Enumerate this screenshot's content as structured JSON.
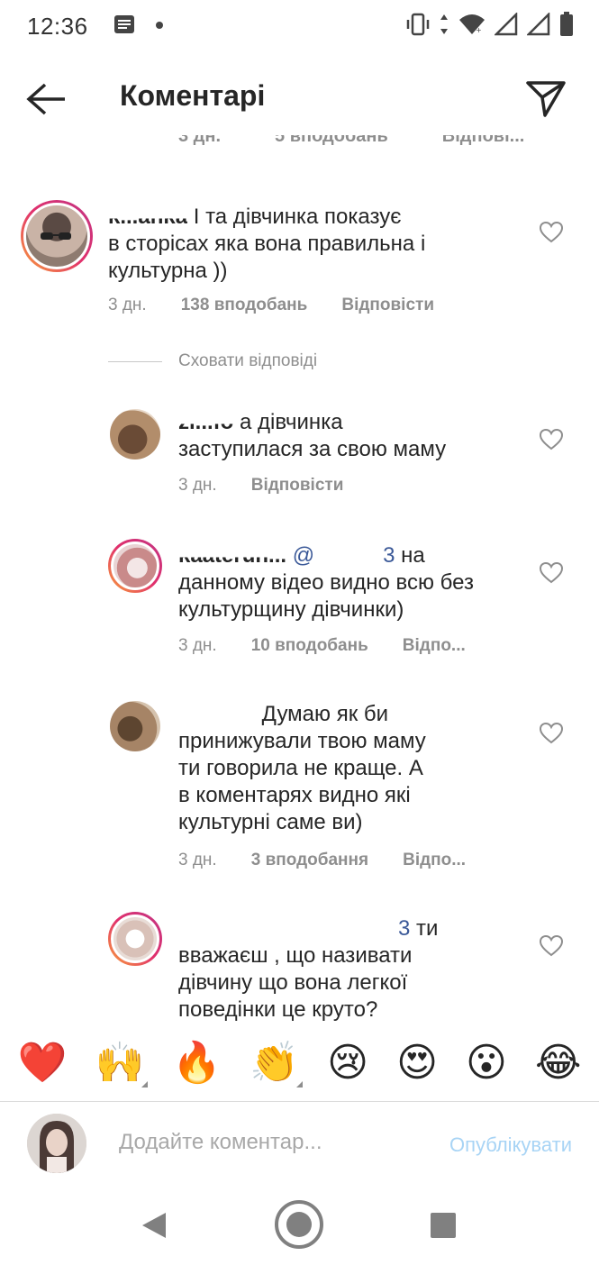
{
  "status_bar": {
    "time": "12:36",
    "icons_left": [
      "notes-icon",
      "dot-icon"
    ],
    "icons_right": [
      "vibrate-icon",
      "data-arrows-icon",
      "wifi-icon",
      "signal-icon",
      "signal-icon-2",
      "battery-icon"
    ]
  },
  "header": {
    "title": "Коментарі",
    "back_icon": "arrow-left-icon",
    "share_icon": "paper-plane-icon"
  },
  "cut_top": {
    "time": "3 дн.",
    "likes": "5 вподобань",
    "reply": "Відпові..."
  },
  "hide_replies_label": "Сховати відповіді",
  "comments": [
    {
      "username": "k...anka",
      "text_line1": "І та дівчинка показує",
      "text_line2": "в сторісах яка вона правильна і",
      "text_line3": "культурна ))",
      "time": "3 дн.",
      "likes": "138 вподобань",
      "reply": "Відповісти"
    },
    {
      "username": "zl...fo",
      "text_line1": "а дівчинка",
      "text_line2": "заступилася за свою маму",
      "time": "3 дн.",
      "reply": "Відповісти"
    },
    {
      "username": "kaaterun...",
      "mention": "@",
      "mention_end": "3",
      "text_line1": "на",
      "text_line2": "данному відео видно всю без",
      "text_line3": "культурщину дівчинки)",
      "time": "3 дн.",
      "likes": "10 вподобань",
      "reply": "Відпо..."
    },
    {
      "username": "",
      "text_line1": "Думаю як би",
      "text_line2": "принижували твою маму",
      "text_line3": "ти говорила не краще. А",
      "text_line4": "в коментарях видно які",
      "text_line5": "культурні саме ви)",
      "time": "3 дн.",
      "likes": "3 вподобання",
      "reply": "Відпо..."
    },
    {
      "username": "",
      "mention_end": "3",
      "text_line1": "ти",
      "text_line2": "вважаєш , що називати",
      "text_line3": "дівчину що вона легкої",
      "text_line4": "поведінки це круто?"
    }
  ],
  "emojis": [
    {
      "char": "❤️",
      "name": "red-heart-icon",
      "has_variants": false
    },
    {
      "char": "🙌",
      "name": "raised-hands-icon",
      "has_variants": true
    },
    {
      "char": "🔥",
      "name": "fire-icon",
      "has_variants": false
    },
    {
      "char": "👏",
      "name": "clapping-hands-icon",
      "has_variants": true
    },
    {
      "char": "😢",
      "name": "crying-face-icon",
      "has_variants": false
    },
    {
      "char": "😍",
      "name": "heart-eyes-icon",
      "has_variants": false
    },
    {
      "char": "😮",
      "name": "surprised-face-icon",
      "has_variants": false
    },
    {
      "char": "😂",
      "name": "tears-of-joy-icon",
      "has_variants": false
    }
  ],
  "input": {
    "placeholder": "Додайте коментар...",
    "publish_label": "Опублікувати"
  },
  "colors": {
    "text": "#262626",
    "muted": "#8e8e8e",
    "publish_disabled": "#a8d4f5",
    "ring_gradient": [
      "#f9a23b",
      "#e1306c",
      "#c13584"
    ]
  }
}
